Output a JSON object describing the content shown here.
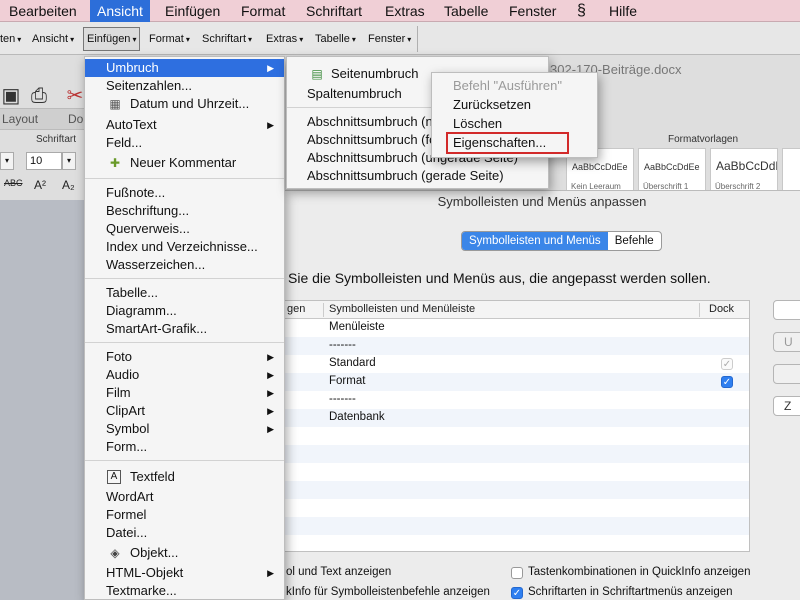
{
  "menubar": {
    "items": [
      "Bearbeiten",
      "Ansicht",
      "Einfügen",
      "Format",
      "Schriftart",
      "Extras",
      "Tabelle",
      "Fenster",
      "Hilfe"
    ],
    "active": "Ansicht",
    "script_icon": "script-icon"
  },
  "toolbar": {
    "items": [
      "ten",
      "Ansicht",
      "Einfügen",
      "Format",
      "Schriftart",
      "Extras",
      "Tabelle",
      "Fenster"
    ],
    "open_item": "Einfügen"
  },
  "ribbon": {
    "doc_title": "302-170-Beiträge.docx",
    "tabs": [
      "Layout",
      "Do"
    ],
    "font_group_label": "Schriftart",
    "font_size": "10",
    "format_buttons": [
      "ABC",
      "A²",
      "A₂"
    ],
    "styles_label": "Formatvorlagen",
    "style_cards": [
      {
        "sample": "AaBbCcDdEe",
        "name": "Kein Leeraum"
      },
      {
        "sample": "AaBbCcDdEe",
        "name": "Überschrift 1"
      },
      {
        "sample": "AaBbCcDdE",
        "name": "Überschrift 2"
      }
    ]
  },
  "insert_menu": {
    "items": [
      {
        "label": "Umbruch",
        "submenu": true,
        "highlight": true
      },
      {
        "label": "Seitenzahlen..."
      },
      {
        "label": "Datum und Uhrzeit...",
        "icon": "calendar-icon"
      },
      {
        "label": "AutoText",
        "submenu": true
      },
      {
        "label": "Feld..."
      },
      {
        "label": "Neuer Kommentar",
        "icon": "comment-icon"
      },
      {
        "label": "Fußnote..."
      },
      {
        "label": "Beschriftung..."
      },
      {
        "label": "Querverweis..."
      },
      {
        "label": "Index und Verzeichnisse..."
      },
      {
        "label": "Wasserzeichen..."
      },
      {
        "label": "Tabelle..."
      },
      {
        "label": "Diagramm..."
      },
      {
        "label": "SmartArt-Grafik..."
      },
      {
        "label": "Foto",
        "submenu": true
      },
      {
        "label": "Audio",
        "submenu": true
      },
      {
        "label": "Film",
        "submenu": true
      },
      {
        "label": "ClipArt",
        "submenu": true
      },
      {
        "label": "Symbol",
        "submenu": true
      },
      {
        "label": "Form..."
      },
      {
        "label": "Textfeld",
        "icon": "textbox-icon"
      },
      {
        "label": "WordArt"
      },
      {
        "label": "Formel"
      },
      {
        "label": "Datei..."
      },
      {
        "label": "Objekt...",
        "icon": "object-icon"
      },
      {
        "label": "HTML-Objekt",
        "submenu": true
      },
      {
        "label": "Textmarke..."
      }
    ]
  },
  "break_menu": {
    "items": [
      {
        "label": "Seitenumbruch",
        "icon": "page-break-icon"
      },
      {
        "label": "Spaltenumbruch"
      },
      {
        "label": "Abschnittsumbruch (nächste Seite)"
      },
      {
        "label": "Abschnittsumbruch (fortlaufend)"
      },
      {
        "label": "Abschnittsumbruch (ungerade Seite)"
      },
      {
        "label": "Abschnittsumbruch (gerade Seite)"
      }
    ]
  },
  "context_menu": {
    "items": [
      {
        "label": "Befehl \"Ausführen\"",
        "disabled": true
      },
      {
        "label": "Zurücksetzen"
      },
      {
        "label": "Löschen"
      },
      {
        "label": "Eigenschaften...",
        "highlighted_box": true
      }
    ]
  },
  "dialog": {
    "title": "Symbolleisten und Menüs anpassen",
    "tabs": [
      "Symbolleisten und Menüs",
      "Befehle"
    ],
    "active_tab": "Symbolleisten und Menüs",
    "instruction": "Sie die Symbolleisten und Menüs aus, die angepasst werden sollen.",
    "columns": [
      "gen",
      "Symbolleisten und Menüleiste",
      "Dock"
    ],
    "rows": [
      {
        "name": "Menüleiste",
        "dock": ""
      },
      {
        "name": "-------",
        "dock": ""
      },
      {
        "name": "Standard",
        "dock": "checked-dim"
      },
      {
        "name": "Format",
        "dock": "checked"
      },
      {
        "name": "-------",
        "dock": ""
      },
      {
        "name": "Datenbank",
        "dock": ""
      }
    ],
    "side_buttons": [
      "",
      "U",
      "",
      "Z"
    ],
    "options": [
      {
        "label": "ol und Text anzeigen"
      },
      {
        "label": "kInfo für Symbolleistenbefehle anzeigen"
      },
      {
        "label": "Tastenkombinationen in QuickInfo anzeigen",
        "checked": false
      },
      {
        "label": "Schriftarten in Schriftartmenüs anzeigen",
        "checked": true
      }
    ]
  }
}
